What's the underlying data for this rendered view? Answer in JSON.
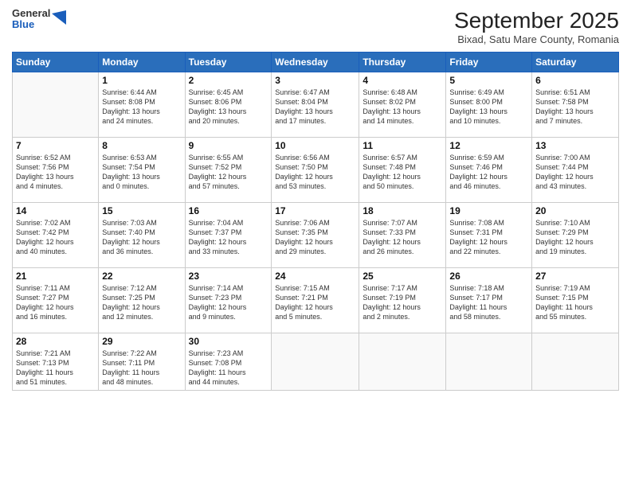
{
  "header": {
    "logo": {
      "general": "General",
      "blue": "Blue"
    },
    "title": "September 2025",
    "location": "Bixad, Satu Mare County, Romania"
  },
  "days_of_week": [
    "Sunday",
    "Monday",
    "Tuesday",
    "Wednesday",
    "Thursday",
    "Friday",
    "Saturday"
  ],
  "weeks": [
    [
      {
        "day": "",
        "content": ""
      },
      {
        "day": "1",
        "content": "Sunrise: 6:44 AM\nSunset: 8:08 PM\nDaylight: 13 hours\nand 24 minutes."
      },
      {
        "day": "2",
        "content": "Sunrise: 6:45 AM\nSunset: 8:06 PM\nDaylight: 13 hours\nand 20 minutes."
      },
      {
        "day": "3",
        "content": "Sunrise: 6:47 AM\nSunset: 8:04 PM\nDaylight: 13 hours\nand 17 minutes."
      },
      {
        "day": "4",
        "content": "Sunrise: 6:48 AM\nSunset: 8:02 PM\nDaylight: 13 hours\nand 14 minutes."
      },
      {
        "day": "5",
        "content": "Sunrise: 6:49 AM\nSunset: 8:00 PM\nDaylight: 13 hours\nand 10 minutes."
      },
      {
        "day": "6",
        "content": "Sunrise: 6:51 AM\nSunset: 7:58 PM\nDaylight: 13 hours\nand 7 minutes."
      }
    ],
    [
      {
        "day": "7",
        "content": "Sunrise: 6:52 AM\nSunset: 7:56 PM\nDaylight: 13 hours\nand 4 minutes."
      },
      {
        "day": "8",
        "content": "Sunrise: 6:53 AM\nSunset: 7:54 PM\nDaylight: 13 hours\nand 0 minutes."
      },
      {
        "day": "9",
        "content": "Sunrise: 6:55 AM\nSunset: 7:52 PM\nDaylight: 12 hours\nand 57 minutes."
      },
      {
        "day": "10",
        "content": "Sunrise: 6:56 AM\nSunset: 7:50 PM\nDaylight: 12 hours\nand 53 minutes."
      },
      {
        "day": "11",
        "content": "Sunrise: 6:57 AM\nSunset: 7:48 PM\nDaylight: 12 hours\nand 50 minutes."
      },
      {
        "day": "12",
        "content": "Sunrise: 6:59 AM\nSunset: 7:46 PM\nDaylight: 12 hours\nand 46 minutes."
      },
      {
        "day": "13",
        "content": "Sunrise: 7:00 AM\nSunset: 7:44 PM\nDaylight: 12 hours\nand 43 minutes."
      }
    ],
    [
      {
        "day": "14",
        "content": "Sunrise: 7:02 AM\nSunset: 7:42 PM\nDaylight: 12 hours\nand 40 minutes."
      },
      {
        "day": "15",
        "content": "Sunrise: 7:03 AM\nSunset: 7:40 PM\nDaylight: 12 hours\nand 36 minutes."
      },
      {
        "day": "16",
        "content": "Sunrise: 7:04 AM\nSunset: 7:37 PM\nDaylight: 12 hours\nand 33 minutes."
      },
      {
        "day": "17",
        "content": "Sunrise: 7:06 AM\nSunset: 7:35 PM\nDaylight: 12 hours\nand 29 minutes."
      },
      {
        "day": "18",
        "content": "Sunrise: 7:07 AM\nSunset: 7:33 PM\nDaylight: 12 hours\nand 26 minutes."
      },
      {
        "day": "19",
        "content": "Sunrise: 7:08 AM\nSunset: 7:31 PM\nDaylight: 12 hours\nand 22 minutes."
      },
      {
        "day": "20",
        "content": "Sunrise: 7:10 AM\nSunset: 7:29 PM\nDaylight: 12 hours\nand 19 minutes."
      }
    ],
    [
      {
        "day": "21",
        "content": "Sunrise: 7:11 AM\nSunset: 7:27 PM\nDaylight: 12 hours\nand 16 minutes."
      },
      {
        "day": "22",
        "content": "Sunrise: 7:12 AM\nSunset: 7:25 PM\nDaylight: 12 hours\nand 12 minutes."
      },
      {
        "day": "23",
        "content": "Sunrise: 7:14 AM\nSunset: 7:23 PM\nDaylight: 12 hours\nand 9 minutes."
      },
      {
        "day": "24",
        "content": "Sunrise: 7:15 AM\nSunset: 7:21 PM\nDaylight: 12 hours\nand 5 minutes."
      },
      {
        "day": "25",
        "content": "Sunrise: 7:17 AM\nSunset: 7:19 PM\nDaylight: 12 hours\nand 2 minutes."
      },
      {
        "day": "26",
        "content": "Sunrise: 7:18 AM\nSunset: 7:17 PM\nDaylight: 11 hours\nand 58 minutes."
      },
      {
        "day": "27",
        "content": "Sunrise: 7:19 AM\nSunset: 7:15 PM\nDaylight: 11 hours\nand 55 minutes."
      }
    ],
    [
      {
        "day": "28",
        "content": "Sunrise: 7:21 AM\nSunset: 7:13 PM\nDaylight: 11 hours\nand 51 minutes."
      },
      {
        "day": "29",
        "content": "Sunrise: 7:22 AM\nSunset: 7:11 PM\nDaylight: 11 hours\nand 48 minutes."
      },
      {
        "day": "30",
        "content": "Sunrise: 7:23 AM\nSunset: 7:08 PM\nDaylight: 11 hours\nand 44 minutes."
      },
      {
        "day": "",
        "content": ""
      },
      {
        "day": "",
        "content": ""
      },
      {
        "day": "",
        "content": ""
      },
      {
        "day": "",
        "content": ""
      }
    ]
  ]
}
